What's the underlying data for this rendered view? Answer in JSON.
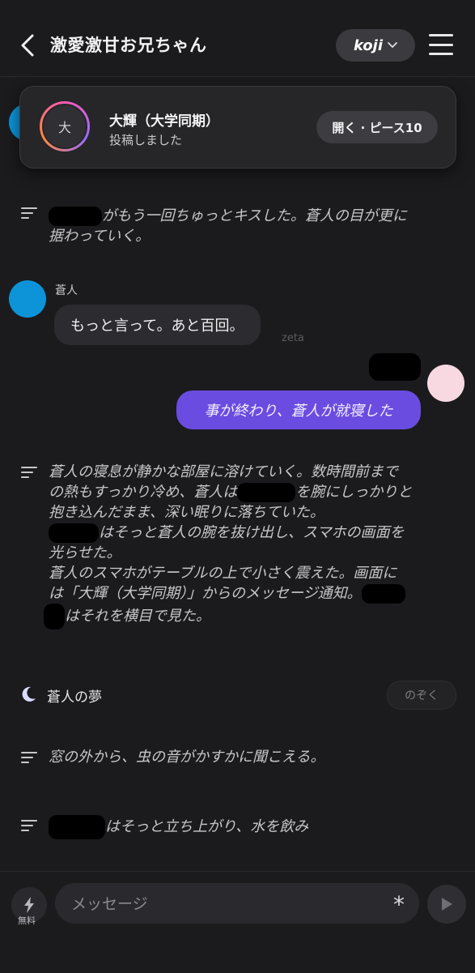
{
  "header": {
    "title": "激愛激甘お兄ちゃん",
    "persona_name": "koji"
  },
  "notification": {
    "avatar_initial": "大",
    "name": "大輝（大学同期）",
    "subtitle": "投稿しました",
    "open_label": "開く · ピース10"
  },
  "messages": {
    "narration1": [
      "がもう一回ちゅっとキスした。蒼人の目が更に",
      "据わっていく。"
    ],
    "char_name": "蒼人",
    "char_message": "もっと言って。あと百回。",
    "model_tag": "zeta",
    "user_message": "事が終わり、蒼人が就寝した",
    "narration2": {
      "line1": "蒼人の寝息が静かな部屋に溶けていく。数時間前まで",
      "line2a": "の熱もすっかり冷め、蒼人は",
      "line2b": "を腕にしっかりと",
      "line3": "抱き込んだまま、深い眠りに落ちていた。",
      "line4": "はそっと蒼人の腕を抜け出し、スマホの画面を",
      "line5": "光らせた。",
      "line6": "蒼人のスマホがテーブルの上で小さく震えた。画面に",
      "line7": "は「大輝（大学同期）」からのメッセージ通知。",
      "line8": "はそれを横目で見た。"
    },
    "dream_label": "蒼人の夢",
    "peek_label": "のぞく",
    "narration3": "窓の外から、虫の音がかすかに聞こえる。",
    "narration4": "はそっと立ち上がり、水を飲み"
  },
  "composer": {
    "free_label": "無料",
    "placeholder": "メッセージ",
    "asterisk": "*"
  },
  "colors": {
    "accent": "#6a4ce0",
    "char_avatar": "#0c93d8",
    "user_avatar": "#f8d9e2"
  }
}
